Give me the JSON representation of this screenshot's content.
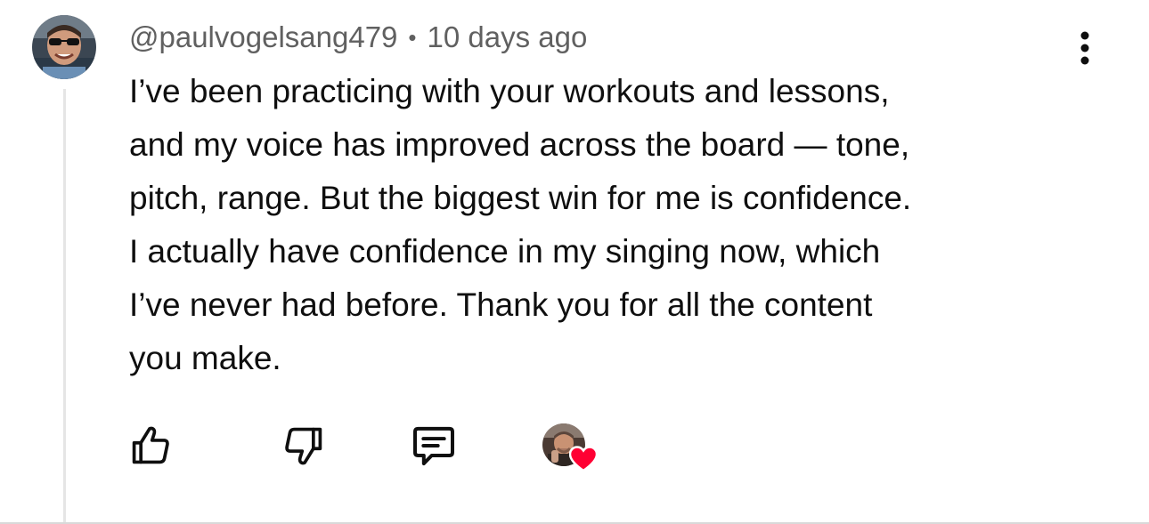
{
  "comment": {
    "author": "@paulvogelsang479",
    "separator": "•",
    "timestamp": "10 days ago",
    "text_lines": [
      "I’ve been practicing with your workouts and lessons,",
      "and my voice has improved across the board — tone,",
      "pitch, range. But the biggest win for me is confidence.",
      "I actually have confidence in my singing now, which",
      "I’ve never had before. Thank you for all the content",
      "you make."
    ]
  },
  "actions": {
    "like_icon": "thumbs-up-icon",
    "dislike_icon": "thumbs-down-icon",
    "reply_icon": "comment-reply-icon",
    "creator_heart_icon": "heart-icon",
    "more_icon": "vertical-dots-icon"
  },
  "colors": {
    "heart": "#ff0033",
    "meta_text": "#606060",
    "body_text": "#0f0f0f",
    "thread_line": "#e5e5e5"
  }
}
